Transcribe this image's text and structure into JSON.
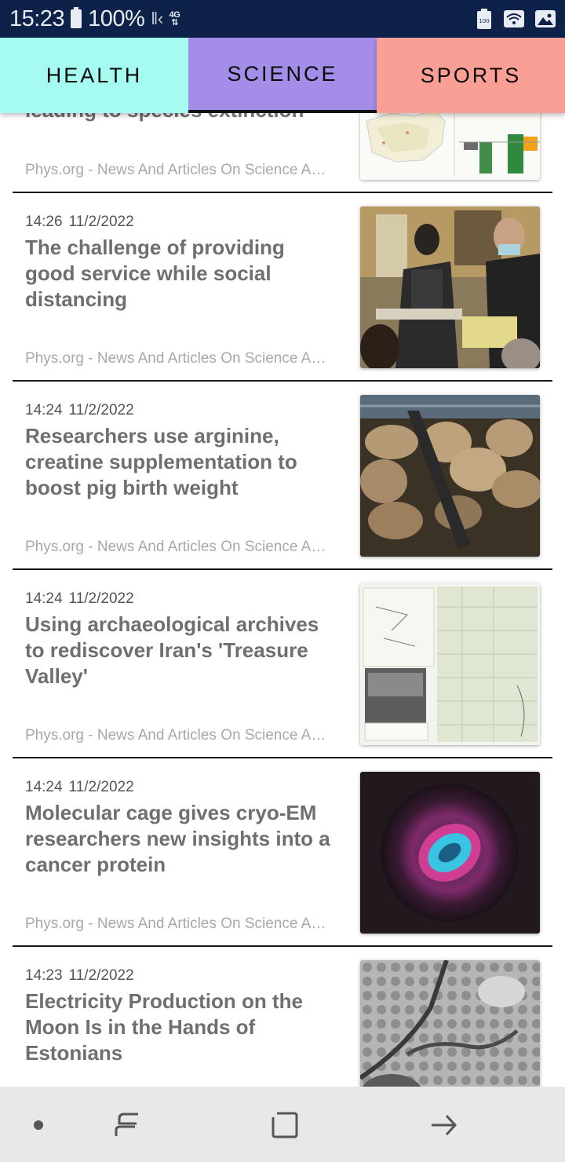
{
  "status_bar": {
    "time": "15:23",
    "battery": "100%",
    "network": "4G",
    "icons": [
      "battery-icon",
      "signal-icon",
      "battery-saver-icon",
      "wifi-icon",
      "image-icon"
    ]
  },
  "tabs": [
    {
      "label": "HEALTH",
      "color": "#a6fbf1",
      "selected": false
    },
    {
      "label": "SCIENCE",
      "color": "#a38de9",
      "selected": true
    },
    {
      "label": "SPORTS",
      "color": "#fa9f96",
      "selected": false
    }
  ],
  "articles": [
    {
      "time": "",
      "date": "",
      "title": "leading to species extinction",
      "source": "Phys.org - News And Articles On Science A…",
      "thumbnail": "map-chart-image"
    },
    {
      "time": "14:26",
      "date": "11/2/2022",
      "title": "The challenge of providing good service while social distancing",
      "source": "Phys.org - News And Articles On Science A…",
      "thumbnail": "waiters-image"
    },
    {
      "time": "14:24",
      "date": "11/2/2022",
      "title": "Researchers use arginine, creatine supplementation to boost pig birth weight",
      "source": "Phys.org - News And Articles On Science A…",
      "thumbnail": "pigs-image"
    },
    {
      "time": "14:24",
      "date": "11/2/2022",
      "title": "Using archaeological archives to rediscover Iran's 'Treasure Valley'",
      "source": "Phys.org - News And Articles On Science A…",
      "thumbnail": "archive-documents-image"
    },
    {
      "time": "14:24",
      "date": "11/2/2022",
      "title": "Molecular cage gives cryo-EM researchers new insights into a cancer protein",
      "source": "Phys.org - News And Articles On Science A…",
      "thumbnail": "cryo-em-image"
    },
    {
      "time": "14:23",
      "date": "11/2/2022",
      "title": "Electricity Production on the Moon Is in the Hands of Estonians",
      "source": "",
      "thumbnail": "moon-surface-image"
    }
  ],
  "nav_bar": {
    "buttons": [
      "dot-icon",
      "recents-icon",
      "home-icon",
      "back-icon"
    ]
  }
}
